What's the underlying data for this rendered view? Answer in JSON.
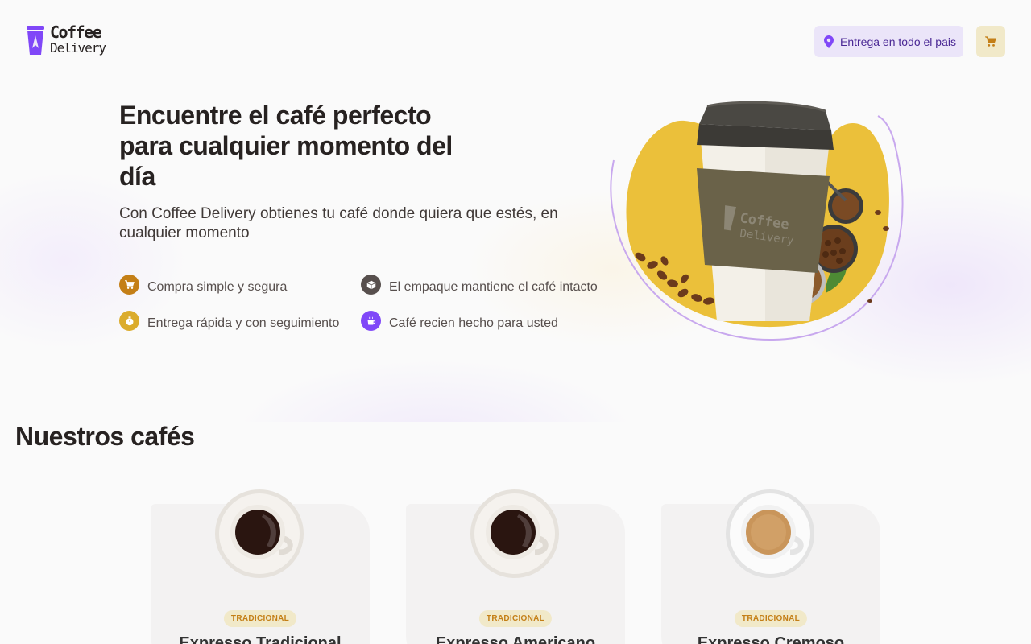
{
  "header": {
    "logo_line1": "Coffee",
    "logo_line2": "Delivery",
    "location_label": "Entrega en todo el pais"
  },
  "hero": {
    "title": "Encuentre el café perfecto para cualquier momento del día",
    "subtitle": "Con Coffee Delivery obtienes tu café donde quiera que estés, en cualquier momento",
    "cup_logo_line1": "Coffee",
    "cup_logo_line2": "Delivery",
    "features": [
      {
        "label": "Compra simple y segura",
        "icon": "cart-icon",
        "color": "#c47f17"
      },
      {
        "label": "El empaque mantiene el café intacto",
        "icon": "package-icon",
        "color": "#574f4d"
      },
      {
        "label": "Entrega rápida y con seguimiento",
        "icon": "timer-icon",
        "color": "#dbac2c"
      },
      {
        "label": "Café recien hecho para usted",
        "icon": "coffee-icon",
        "color": "#8047f8"
      }
    ]
  },
  "section": {
    "title": "Nuestros cafés"
  },
  "coffees": [
    {
      "tag": "TRADICIONAL",
      "name": "Expresso Tradicional"
    },
    {
      "tag": "TRADICIONAL",
      "name": "Expresso Americano"
    },
    {
      "tag": "TRADICIONAL",
      "name": "Expresso Cremoso"
    }
  ],
  "colors": {
    "purple": "#8047f8",
    "yellow": "#dbac2c",
    "yellow_dark": "#c47f17",
    "base_title": "#272221"
  }
}
